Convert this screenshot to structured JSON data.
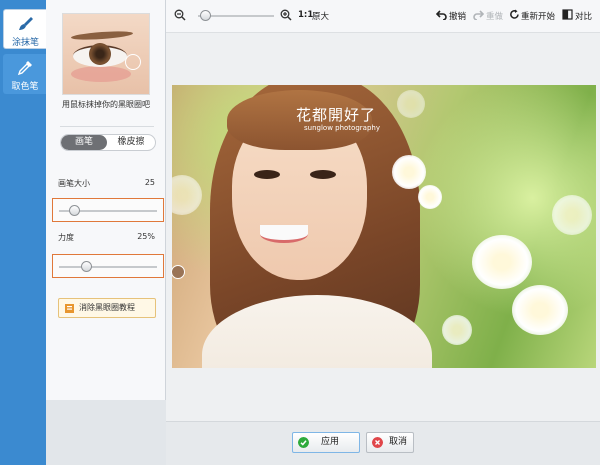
{
  "rail": {
    "tools": [
      {
        "label": "涂抹笔",
        "icon": "brush-icon",
        "active": true
      },
      {
        "label": "取色笔",
        "icon": "eyedropper-icon",
        "active": false
      }
    ]
  },
  "panel": {
    "preview_caption": "用鼠标抹掉你的黑眼圈吧",
    "mode_tabs": [
      "画笔",
      "橡皮擦"
    ],
    "mode_selected": "画笔",
    "brush_size": {
      "label": "画笔大小",
      "value": "25",
      "level": 0.12
    },
    "strength": {
      "label": "力度",
      "value": "25%",
      "level": 0.25
    },
    "tutorial_label": "消除黑眼圈教程"
  },
  "toolbar": {
    "zoom_level": 0.05,
    "actual_size_prefix": "1:1",
    "actual_size_label": "原大",
    "undo_label": "撤销",
    "redo_label": "重做",
    "restart_label": "重新开始",
    "compare_label": "对比"
  },
  "photo": {
    "watermark": "花都開好了",
    "watermark_sub": "sunglow photography"
  },
  "footer": {
    "apply_label": "应用",
    "cancel_label": "取消"
  },
  "colors": {
    "rail": "#3b8ad0",
    "highlight": "#e0783a",
    "apply_icon": "#2eaa3c",
    "cancel_icon": "#e0464a"
  }
}
